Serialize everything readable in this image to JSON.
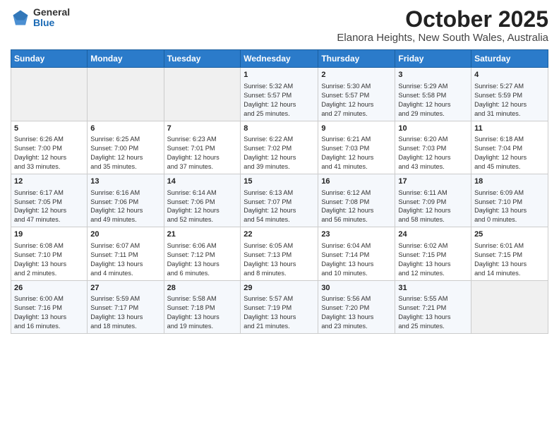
{
  "header": {
    "logo_general": "General",
    "logo_blue": "Blue",
    "month_title": "October 2025",
    "location": "Elanora Heights, New South Wales, Australia"
  },
  "weekdays": [
    "Sunday",
    "Monday",
    "Tuesday",
    "Wednesday",
    "Thursday",
    "Friday",
    "Saturday"
  ],
  "weeks": [
    [
      {
        "day": "",
        "content": ""
      },
      {
        "day": "",
        "content": ""
      },
      {
        "day": "",
        "content": ""
      },
      {
        "day": "1",
        "content": "Sunrise: 5:32 AM\nSunset: 5:57 PM\nDaylight: 12 hours\nand 25 minutes."
      },
      {
        "day": "2",
        "content": "Sunrise: 5:30 AM\nSunset: 5:57 PM\nDaylight: 12 hours\nand 27 minutes."
      },
      {
        "day": "3",
        "content": "Sunrise: 5:29 AM\nSunset: 5:58 PM\nDaylight: 12 hours\nand 29 minutes."
      },
      {
        "day": "4",
        "content": "Sunrise: 5:27 AM\nSunset: 5:59 PM\nDaylight: 12 hours\nand 31 minutes."
      }
    ],
    [
      {
        "day": "5",
        "content": "Sunrise: 6:26 AM\nSunset: 7:00 PM\nDaylight: 12 hours\nand 33 minutes."
      },
      {
        "day": "6",
        "content": "Sunrise: 6:25 AM\nSunset: 7:00 PM\nDaylight: 12 hours\nand 35 minutes."
      },
      {
        "day": "7",
        "content": "Sunrise: 6:23 AM\nSunset: 7:01 PM\nDaylight: 12 hours\nand 37 minutes."
      },
      {
        "day": "8",
        "content": "Sunrise: 6:22 AM\nSunset: 7:02 PM\nDaylight: 12 hours\nand 39 minutes."
      },
      {
        "day": "9",
        "content": "Sunrise: 6:21 AM\nSunset: 7:03 PM\nDaylight: 12 hours\nand 41 minutes."
      },
      {
        "day": "10",
        "content": "Sunrise: 6:20 AM\nSunset: 7:03 PM\nDaylight: 12 hours\nand 43 minutes."
      },
      {
        "day": "11",
        "content": "Sunrise: 6:18 AM\nSunset: 7:04 PM\nDaylight: 12 hours\nand 45 minutes."
      }
    ],
    [
      {
        "day": "12",
        "content": "Sunrise: 6:17 AM\nSunset: 7:05 PM\nDaylight: 12 hours\nand 47 minutes."
      },
      {
        "day": "13",
        "content": "Sunrise: 6:16 AM\nSunset: 7:06 PM\nDaylight: 12 hours\nand 49 minutes."
      },
      {
        "day": "14",
        "content": "Sunrise: 6:14 AM\nSunset: 7:06 PM\nDaylight: 12 hours\nand 52 minutes."
      },
      {
        "day": "15",
        "content": "Sunrise: 6:13 AM\nSunset: 7:07 PM\nDaylight: 12 hours\nand 54 minutes."
      },
      {
        "day": "16",
        "content": "Sunrise: 6:12 AM\nSunset: 7:08 PM\nDaylight: 12 hours\nand 56 minutes."
      },
      {
        "day": "17",
        "content": "Sunrise: 6:11 AM\nSunset: 7:09 PM\nDaylight: 12 hours\nand 58 minutes."
      },
      {
        "day": "18",
        "content": "Sunrise: 6:09 AM\nSunset: 7:10 PM\nDaylight: 13 hours\nand 0 minutes."
      }
    ],
    [
      {
        "day": "19",
        "content": "Sunrise: 6:08 AM\nSunset: 7:10 PM\nDaylight: 13 hours\nand 2 minutes."
      },
      {
        "day": "20",
        "content": "Sunrise: 6:07 AM\nSunset: 7:11 PM\nDaylight: 13 hours\nand 4 minutes."
      },
      {
        "day": "21",
        "content": "Sunrise: 6:06 AM\nSunset: 7:12 PM\nDaylight: 13 hours\nand 6 minutes."
      },
      {
        "day": "22",
        "content": "Sunrise: 6:05 AM\nSunset: 7:13 PM\nDaylight: 13 hours\nand 8 minutes."
      },
      {
        "day": "23",
        "content": "Sunrise: 6:04 AM\nSunset: 7:14 PM\nDaylight: 13 hours\nand 10 minutes."
      },
      {
        "day": "24",
        "content": "Sunrise: 6:02 AM\nSunset: 7:15 PM\nDaylight: 13 hours\nand 12 minutes."
      },
      {
        "day": "25",
        "content": "Sunrise: 6:01 AM\nSunset: 7:15 PM\nDaylight: 13 hours\nand 14 minutes."
      }
    ],
    [
      {
        "day": "26",
        "content": "Sunrise: 6:00 AM\nSunset: 7:16 PM\nDaylight: 13 hours\nand 16 minutes."
      },
      {
        "day": "27",
        "content": "Sunrise: 5:59 AM\nSunset: 7:17 PM\nDaylight: 13 hours\nand 18 minutes."
      },
      {
        "day": "28",
        "content": "Sunrise: 5:58 AM\nSunset: 7:18 PM\nDaylight: 13 hours\nand 19 minutes."
      },
      {
        "day": "29",
        "content": "Sunrise: 5:57 AM\nSunset: 7:19 PM\nDaylight: 13 hours\nand 21 minutes."
      },
      {
        "day": "30",
        "content": "Sunrise: 5:56 AM\nSunset: 7:20 PM\nDaylight: 13 hours\nand 23 minutes."
      },
      {
        "day": "31",
        "content": "Sunrise: 5:55 AM\nSunset: 7:21 PM\nDaylight: 13 hours\nand 25 minutes."
      },
      {
        "day": "",
        "content": ""
      }
    ]
  ]
}
